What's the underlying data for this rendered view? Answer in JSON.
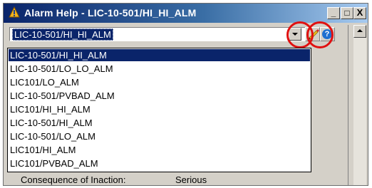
{
  "window": {
    "title": "Alarm Help - LIC-10-501/HI_HI_ALM",
    "minimize_label": "_",
    "maximize_label": "□",
    "close_label": "X"
  },
  "combo": {
    "value": "LIC-10-501/HI_HI_ALM"
  },
  "dropdown": {
    "items": [
      "LIC-10-501/HI_HI_ALM",
      "LIC-10-501/LO_LO_ALM",
      "LIC101/LO_ALM",
      "LIC-10-501/PVBAD_ALM",
      "LIC101/HI_HI_ALM",
      "LIC-10-501/HI_ALM",
      "LIC-10-501/LO_ALM",
      "LIC101/HI_ALM",
      "LIC101/PVBAD_ALM"
    ],
    "selected_index": 0
  },
  "details": {
    "consequence_label": "Consequence of Inaction:",
    "consequence_value": "Serious"
  },
  "toolbar": {
    "help_glyph": "?"
  },
  "colors": {
    "selection": "#0a246a",
    "highlight_circle": "#e01010"
  }
}
